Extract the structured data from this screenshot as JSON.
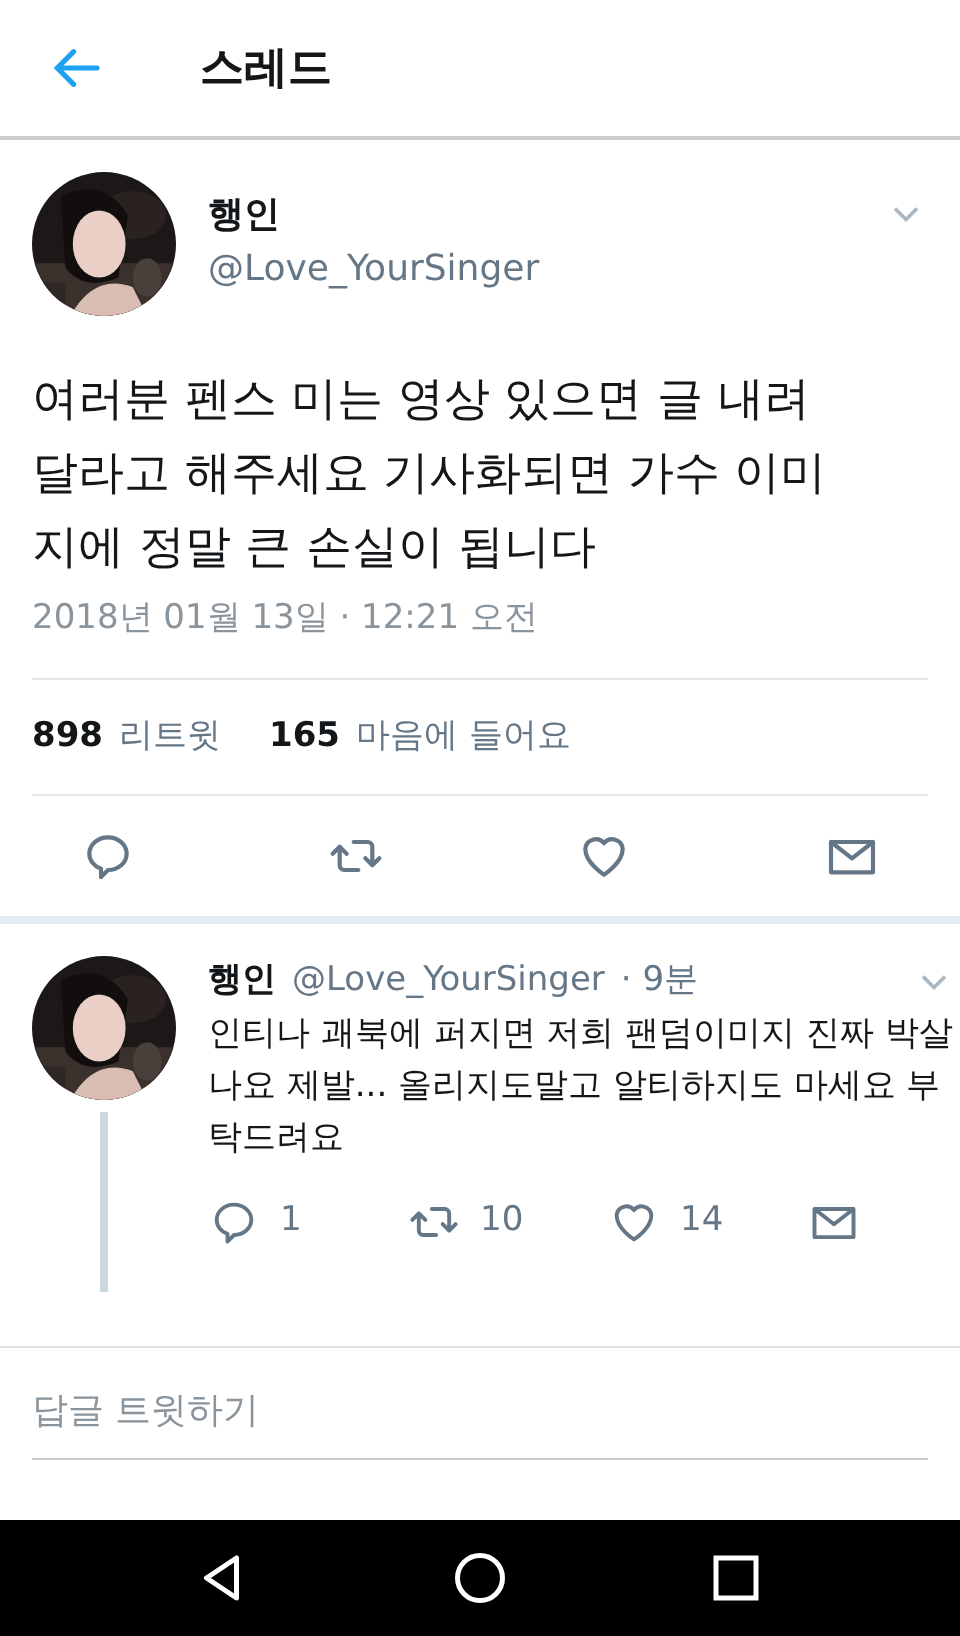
{
  "header": {
    "title": "스레드"
  },
  "tweet": {
    "name": "행인",
    "handle": "@Love_YourSinger",
    "text": "여러분 펜스 미는 영상 있으면 글 내려달라고 해주세요 기사화되면 가수 이미지에 정말 큰 손실이 됩니다",
    "date": "2018년 01월 13일 · 12:21 오전",
    "stats": [
      {
        "count": "898",
        "label": "리트윗"
      },
      {
        "count": "165",
        "label": "마음에 들어요"
      }
    ]
  },
  "replies": [
    {
      "name": "행인",
      "handle": "@Love_YourSinger",
      "time": "· 9분",
      "text": "인티나 괘북에 퍼지면 저희 팬덤이미지 진짜 박살나요 제발... 올리지도말고 알티하지도 마세요 부탁드려요",
      "reply_count": "1",
      "retweet_count": "10",
      "like_count": "14"
    }
  ],
  "reply_box": {
    "placeholder": "답글 트윗하기"
  }
}
